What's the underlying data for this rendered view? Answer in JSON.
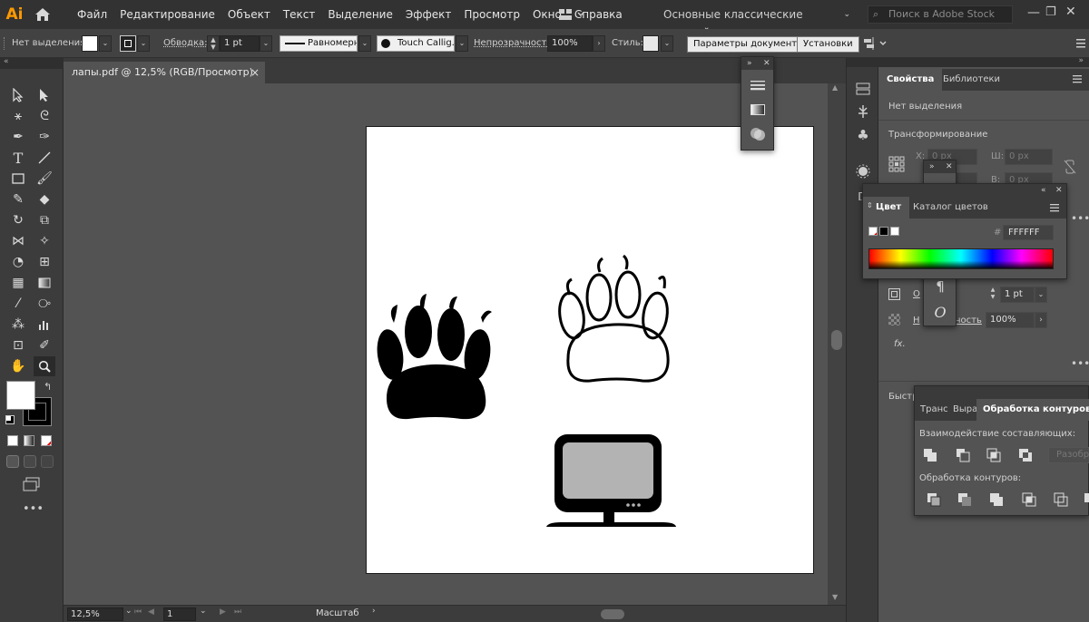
{
  "app": {
    "logo_text": "Ai",
    "menu": [
      "Файл",
      "Редактирование",
      "Объект",
      "Текст",
      "Выделение",
      "Эффект",
      "Просмотр",
      "Окно",
      "Справка"
    ],
    "workspace": "Основные классические настройки",
    "stock_search_placeholder": "Поиск в Adobe Stock"
  },
  "control_bar": {
    "selection_label": "Нет выделения",
    "stroke_label": "Обводка:",
    "stroke_weight": "1 pt",
    "stroke_profile": "Равномерно",
    "brush": "Touch Callig...",
    "opacity_label": "Непрозрачность:",
    "opacity_value": "100%",
    "style_label": "Стиль:",
    "doc_setup_button": "Параметры документа",
    "preferences_button": "Установки"
  },
  "document": {
    "tab_title": "лапы.pdf @ 12,5% (RGB/Просмотр)",
    "close_glyph": "×"
  },
  "status_bar": {
    "zoom": "12,5%",
    "artboard_number": "1",
    "tool_name": "Масштаб"
  },
  "properties_panel": {
    "tabs": [
      "Свойства",
      "Библиотеки"
    ],
    "no_selection": "Нет выделения",
    "transform_label": "Трансформирование",
    "x_label": "X:",
    "x_value": "0 px",
    "w_label": "Ш:",
    "w_value": "0 px",
    "y_value": "0 px",
    "b_label": "В:",
    "b_value": "0 px",
    "stroke_weight": "1 pt",
    "stroke_short": "О",
    "opacity_short": "Н",
    "opacity_suffix": "ность",
    "opacity_value": "100%",
    "fx_label": "fx.",
    "quick_actions_label": "Быстр"
  },
  "color_panel": {
    "tabs": [
      "Цвет",
      "Каталог цветов"
    ],
    "hex_symbol": "#",
    "hex_value": "FFFFFF"
  },
  "pathfinder_panel": {
    "tabs": [
      "Транс",
      "Выра",
      "Обработка контуров"
    ],
    "shape_modes_label": "Взаимодействие составляющих:",
    "expand_button": "Разобра",
    "pathfinders_label": "Обработка контуров:"
  },
  "colors": {
    "accent": "#ff9a00",
    "ui_dark": "#323232",
    "canvas_gray": "#535353",
    "monitor_screen": "#b3b3b3"
  }
}
